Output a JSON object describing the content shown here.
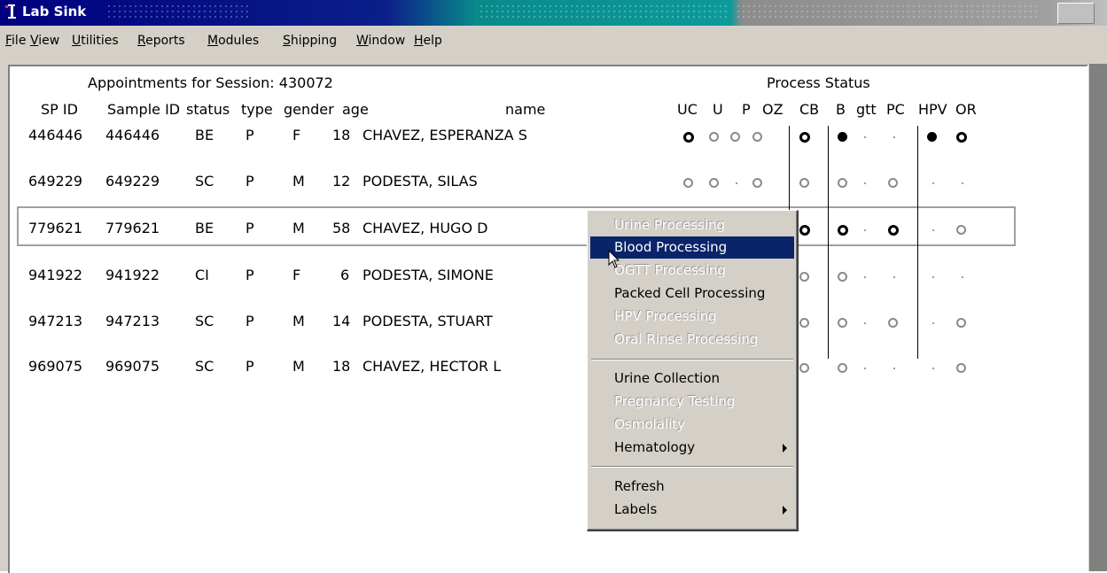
{
  "window": {
    "title": "Lab Sink"
  },
  "menu": [
    "File",
    "View",
    "Utilities",
    "Reports",
    "Modules",
    "Shipping",
    "Window",
    "Help"
  ],
  "menu_underline": [
    "F",
    "V",
    "U",
    "R",
    "M",
    "S",
    "W",
    "H"
  ],
  "session": {
    "label": "Appointments for Session: 430072",
    "process_status_label": "Process Status"
  },
  "columns": {
    "sp_id": "SP ID",
    "sample_id": "Sample ID",
    "status": "status",
    "type": "type",
    "gender": "gender",
    "age": "age",
    "name": "name",
    "process": [
      "UC",
      "U",
      "P",
      "OZ",
      "CB",
      "B",
      "gtt",
      "PC",
      "HPV",
      "OR"
    ]
  },
  "rows": [
    {
      "sp_id": "446446",
      "sample_id": "446446",
      "status": "BE",
      "type": "P",
      "gender": "F",
      "age": "18",
      "name": "CHAVEZ, ESPERANZA S",
      "process": [
        "bold",
        "grey",
        "grey",
        "grey",
        "bold",
        "fill",
        "dot",
        "dot",
        "fill",
        "bold"
      ]
    },
    {
      "sp_id": "649229",
      "sample_id": "649229",
      "status": "SC",
      "type": "P",
      "gender": "M",
      "age": "12",
      "name": "PODESTA, SILAS",
      "process": [
        "grey",
        "grey",
        "dot",
        "grey",
        "grey",
        "grey",
        "dot",
        "grey",
        "dot",
        "dot"
      ]
    },
    {
      "sp_id": "779621",
      "sample_id": "779621",
      "status": "BE",
      "type": "P",
      "gender": "M",
      "age": "58",
      "name": "CHAVEZ, HUGO D",
      "process": [
        "",
        "",
        "",
        "",
        "bold",
        "bold",
        "dot",
        "bold",
        "dot",
        "grey"
      ]
    },
    {
      "sp_id": "941922",
      "sample_id": "941922",
      "status": "CI",
      "type": "P",
      "gender": "F",
      "age": "6",
      "name": "PODESTA, SIMONE",
      "process": [
        "",
        "",
        "",
        "",
        "grey",
        "grey",
        "dot",
        "dot",
        "dot",
        "dot"
      ]
    },
    {
      "sp_id": "947213",
      "sample_id": "947213",
      "status": "SC",
      "type": "P",
      "gender": "M",
      "age": "14",
      "name": "PODESTA, STUART",
      "process": [
        "",
        "",
        "",
        "",
        "grey",
        "grey",
        "dot",
        "grey",
        "dot",
        "grey"
      ]
    },
    {
      "sp_id": "969075",
      "sample_id": "969075",
      "status": "SC",
      "type": "P",
      "gender": "M",
      "age": "18",
      "name": "CHAVEZ, HECTOR L",
      "process": [
        "",
        "",
        "",
        "",
        "grey",
        "grey",
        "dot",
        "dot",
        "dot",
        "grey"
      ]
    }
  ],
  "selected_row": "779621",
  "context_menu": {
    "items": [
      {
        "label": "Urine Processing",
        "enabled": false
      },
      {
        "label": "Blood Processing",
        "enabled": true,
        "highlighted": true
      },
      {
        "label": "OGTT Processing",
        "enabled": false
      },
      {
        "label": "Packed Cell Processing",
        "enabled": true
      },
      {
        "label": "HPV Processing",
        "enabled": false
      },
      {
        "label": "Oral Rinse Processing",
        "enabled": false
      },
      {
        "label": "Urine Collection",
        "enabled": true
      },
      {
        "label": "Pregnancy Testing",
        "enabled": false
      },
      {
        "label": "Osmolality",
        "enabled": false
      },
      {
        "label": "Hematology",
        "enabled": true,
        "submenu": true
      },
      {
        "label": "Refresh",
        "enabled": true
      },
      {
        "label": "Labels",
        "enabled": true,
        "submenu": true
      }
    ]
  },
  "colors": {
    "title_active": "#000080",
    "menu_highlight": "#0a246a",
    "face": "#d4d0c8"
  }
}
